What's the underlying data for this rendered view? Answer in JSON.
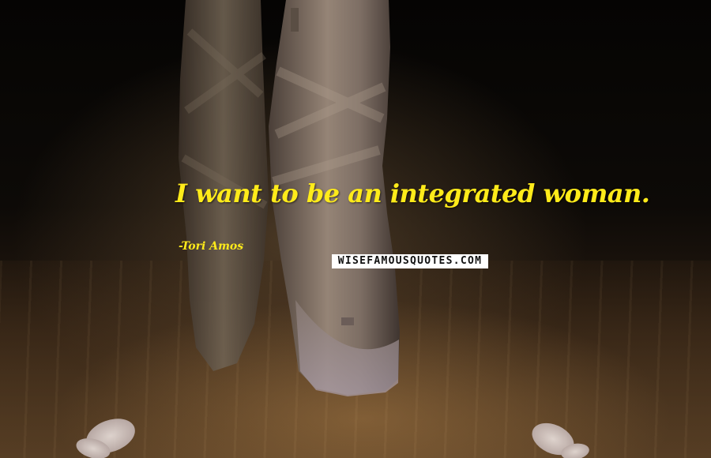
{
  "quote": {
    "text": "I want to be an integrated woman.",
    "author": "-Tori Amos"
  },
  "watermark": {
    "text": "WISEFAMOUSQUOTES.COM"
  },
  "colors": {
    "quote_text": "#ffeb1a",
    "watermark_bg": "#ffffff",
    "watermark_text": "#111111"
  }
}
